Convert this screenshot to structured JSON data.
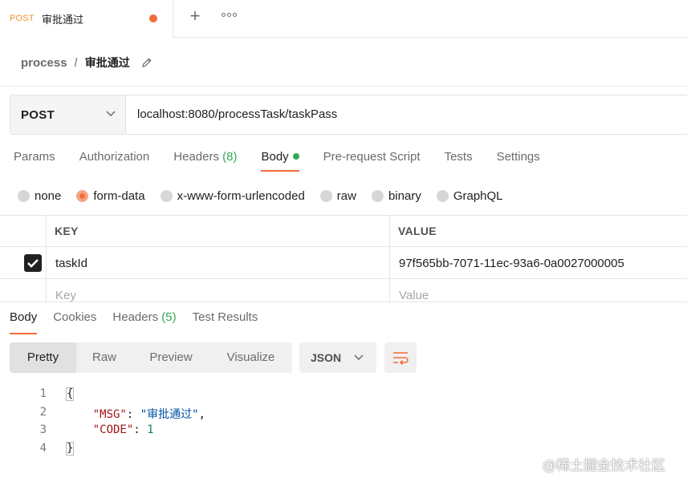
{
  "tabstrip": {
    "request_tab": {
      "method": "POST",
      "name": "审批通过",
      "unsaved": true
    },
    "new_tab_glyph": "+",
    "more_icon": "more-horizontal-icon"
  },
  "breadcrumb": {
    "parent": "process",
    "separator": "/",
    "current": "审批通过",
    "edit_icon": "pencil-icon"
  },
  "request": {
    "method": "POST",
    "url": "localhost:8080/processTask/taskPass"
  },
  "request_tabs": {
    "params": "Params",
    "authorization": "Authorization",
    "headers": "Headers",
    "headers_count": "(8)",
    "body": "Body",
    "prerequest": "Pre-request Script",
    "tests": "Tests",
    "settings": "Settings",
    "active": "Body"
  },
  "body_types": {
    "none": "none",
    "form_data": "form-data",
    "urlencoded": "x-www-form-urlencoded",
    "raw": "raw",
    "binary": "binary",
    "graphql": "GraphQL",
    "selected": "form-data"
  },
  "form_table": {
    "key_header": "KEY",
    "value_header": "VALUE",
    "rows": [
      {
        "checked": true,
        "key": "taskId",
        "value": "97f565bb-7071-11ec-93a6-0a0027000005"
      }
    ],
    "key_placeholder": "Key",
    "value_placeholder": "Value"
  },
  "response_tabs": {
    "body": "Body",
    "cookies": "Cookies",
    "headers": "Headers",
    "headers_count": "(5)",
    "test_results": "Test Results",
    "active": "Body"
  },
  "view_modes": {
    "pretty": "Pretty",
    "raw": "Raw",
    "preview": "Preview",
    "visualize": "Visualize",
    "active": "Pretty"
  },
  "format_select": "JSON",
  "wrap_icon": "wrap-lines-icon",
  "response_body": {
    "line_numbers": [
      "1",
      "2",
      "3",
      "4"
    ],
    "open_brace": "{",
    "msg_key": "\"MSG\"",
    "msg_value": "\"审批通过\"",
    "code_key": "\"CODE\"",
    "code_value": "1",
    "close_brace": "}"
  },
  "watermark": "@稀土掘金技术社区",
  "colors": {
    "accent": "#f26b3a",
    "count_green": "#34a853",
    "method_orange": "#f0932b"
  }
}
